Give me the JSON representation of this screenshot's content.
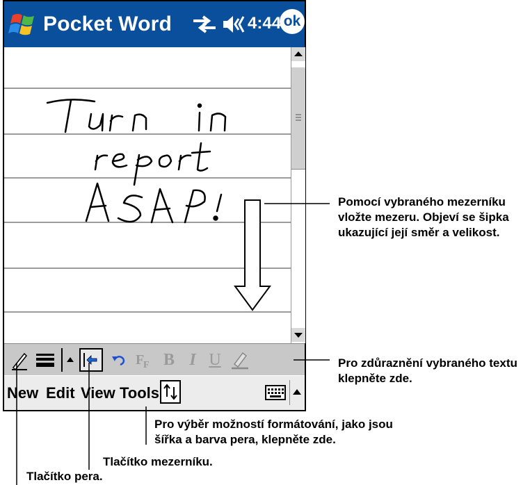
{
  "titlebar": {
    "app_title": "Pocket Word",
    "time": "4:44",
    "ok_label": "ok",
    "icons": [
      "windows-start-icon",
      "connectivity-icon",
      "speaker-icon"
    ]
  },
  "document": {
    "handwriting_lines": [
      "Turn in",
      "report",
      "ASAP!"
    ]
  },
  "toolbar": {
    "icons": [
      "pen-icon",
      "line-weight-icon",
      "dropdown-arrow-icon",
      "space-insert-icon",
      "undo-icon",
      "format-icon",
      "bold-icon",
      "italic-icon",
      "underline-icon",
      "highlight-icon"
    ],
    "bold_glyph": "B",
    "italic_glyph": "I",
    "underline_glyph": "U"
  },
  "menubar": {
    "items": [
      "New",
      "Edit",
      "View",
      "Tools"
    ],
    "icons": [
      "spacing-arrows-icon",
      "keyboard-icon",
      "input-panel-arrow-icon"
    ]
  },
  "callouts": {
    "space_tool": "Pomocí vybraného mezerníku vložte mezeru. Objeví se šipka ukazující její směr a velikost.",
    "highlight": "Pro zdůraznění vybraného textu klepněte zde.",
    "format": "Pro výběr možností formátování, jako jsou šířka a barva pera, klepněte zde.",
    "space_button": "Tlačítko mezerníku.",
    "pen_button": "Tlačítko pera."
  }
}
